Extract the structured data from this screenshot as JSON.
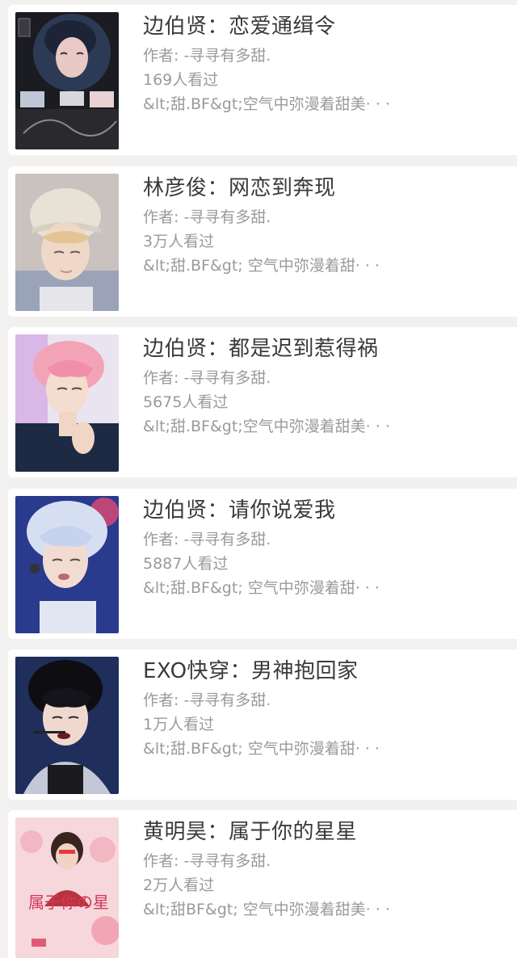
{
  "books": [
    {
      "title": "边伯贤：恋爱通缉令",
      "author": "作者: -寻寻有多甜.",
      "views": "169人看过",
      "summary": "&lt;甜.BF&gt;空气中弥漫着甜美· · ·",
      "cover_icon": "cover-image-dark-poster"
    },
    {
      "title": "林彦俊：网恋到奔现",
      "author": "作者: -寻寻有多甜.",
      "views": "3万人看过",
      "summary": "&lt;甜.BF&gt; 空气中弥漫着甜· · ·",
      "cover_icon": "cover-image-beanie-portrait"
    },
    {
      "title": "边伯贤：都是迟到惹得祸",
      "author": "作者: -寻寻有多甜.",
      "views": "5675人看过",
      "summary": "&lt;甜.BF&gt;空气中弥漫着甜美· · ·",
      "cover_icon": "cover-image-pink-hair-portrait"
    },
    {
      "title": "边伯贤：请你说爱我",
      "author": "作者: -寻寻有多甜.",
      "views": "5887人看过",
      "summary": "&lt;甜.BF&gt; 空气中弥漫着甜· · ·",
      "cover_icon": "cover-image-stage-portrait"
    },
    {
      "title": "EXO快穿：男神抱回家",
      "author": "作者: -寻寻有多甜.",
      "views": "1万人看过",
      "summary": "&lt;甜.BF&gt; 空气中弥漫着甜· · ·",
      "cover_icon": "cover-image-dark-hair-portrait"
    },
    {
      "title": "黄明昊：属于你的星星",
      "author": "作者: -寻寻有多甜.",
      "views": "2万人看过",
      "summary": "&lt;甜BF&gt; 空气中弥漫着甜美· · ·",
      "cover_icon": "cover-image-pink-poster",
      "cover_text": "属于你の星"
    }
  ],
  "colors": {
    "background": "#f2f1ef",
    "card": "#ffffff",
    "title": "#3a3a3a",
    "meta": "#9a9a9a"
  }
}
